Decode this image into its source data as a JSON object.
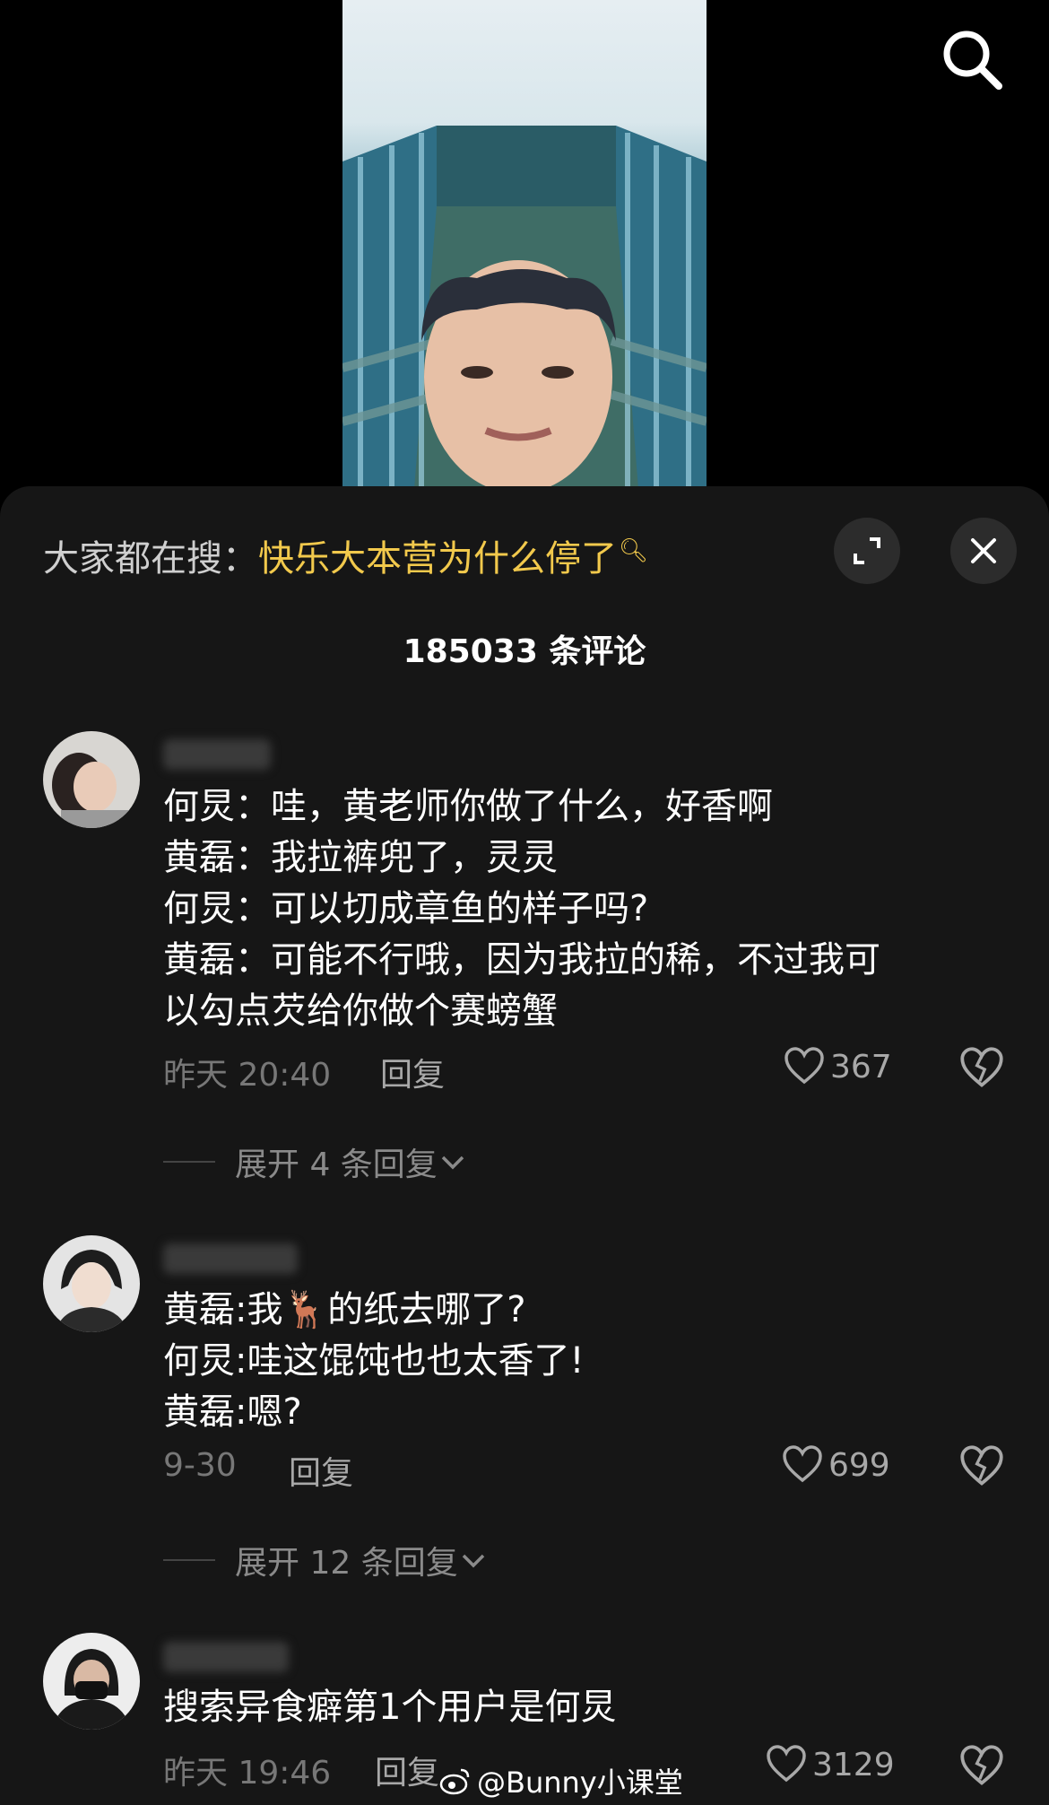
{
  "top": {
    "search_icon": "search-icon"
  },
  "header": {
    "hot_label": "大家都在搜：",
    "hot_query": "快乐大本营为什么停了",
    "expand_icon": "expand-icon",
    "close_icon": "close-icon"
  },
  "comment_count": "185033 条评论",
  "comments": [
    {
      "lines": [
        "何炅：哇，黄老师你做了什么，好香啊",
        "黄磊：我拉裤兜了，灵灵",
        "何炅：可以切成章鱼的样子吗?",
        "黄磊：可能不行哦，因为我拉的稀，不过我可",
        "以勾点芡给你做个赛螃蟹"
      ],
      "time": "昨天 20:40",
      "reply_label": "回复",
      "likes": "367",
      "expand_label": "展开 4 条回复"
    },
    {
      "lines": [
        "黄磊:我🦌的纸去哪了?",
        "何炅:哇这馄饨也也太香了!",
        "黄磊:嗯?"
      ],
      "time": "9-30",
      "reply_label": "回复",
      "likes": "699",
      "expand_label": "展开 12 条回复"
    },
    {
      "lines": [
        "搜索异食癖第1个用户是何炅"
      ],
      "time": "昨天 19:46",
      "reply_label": "回复",
      "likes": "3129"
    }
  ],
  "watermark": "@Bunny小课堂",
  "colors": {
    "accent": "#f2c94c",
    "sheet_bg": "#161616",
    "muted": "#777777"
  }
}
